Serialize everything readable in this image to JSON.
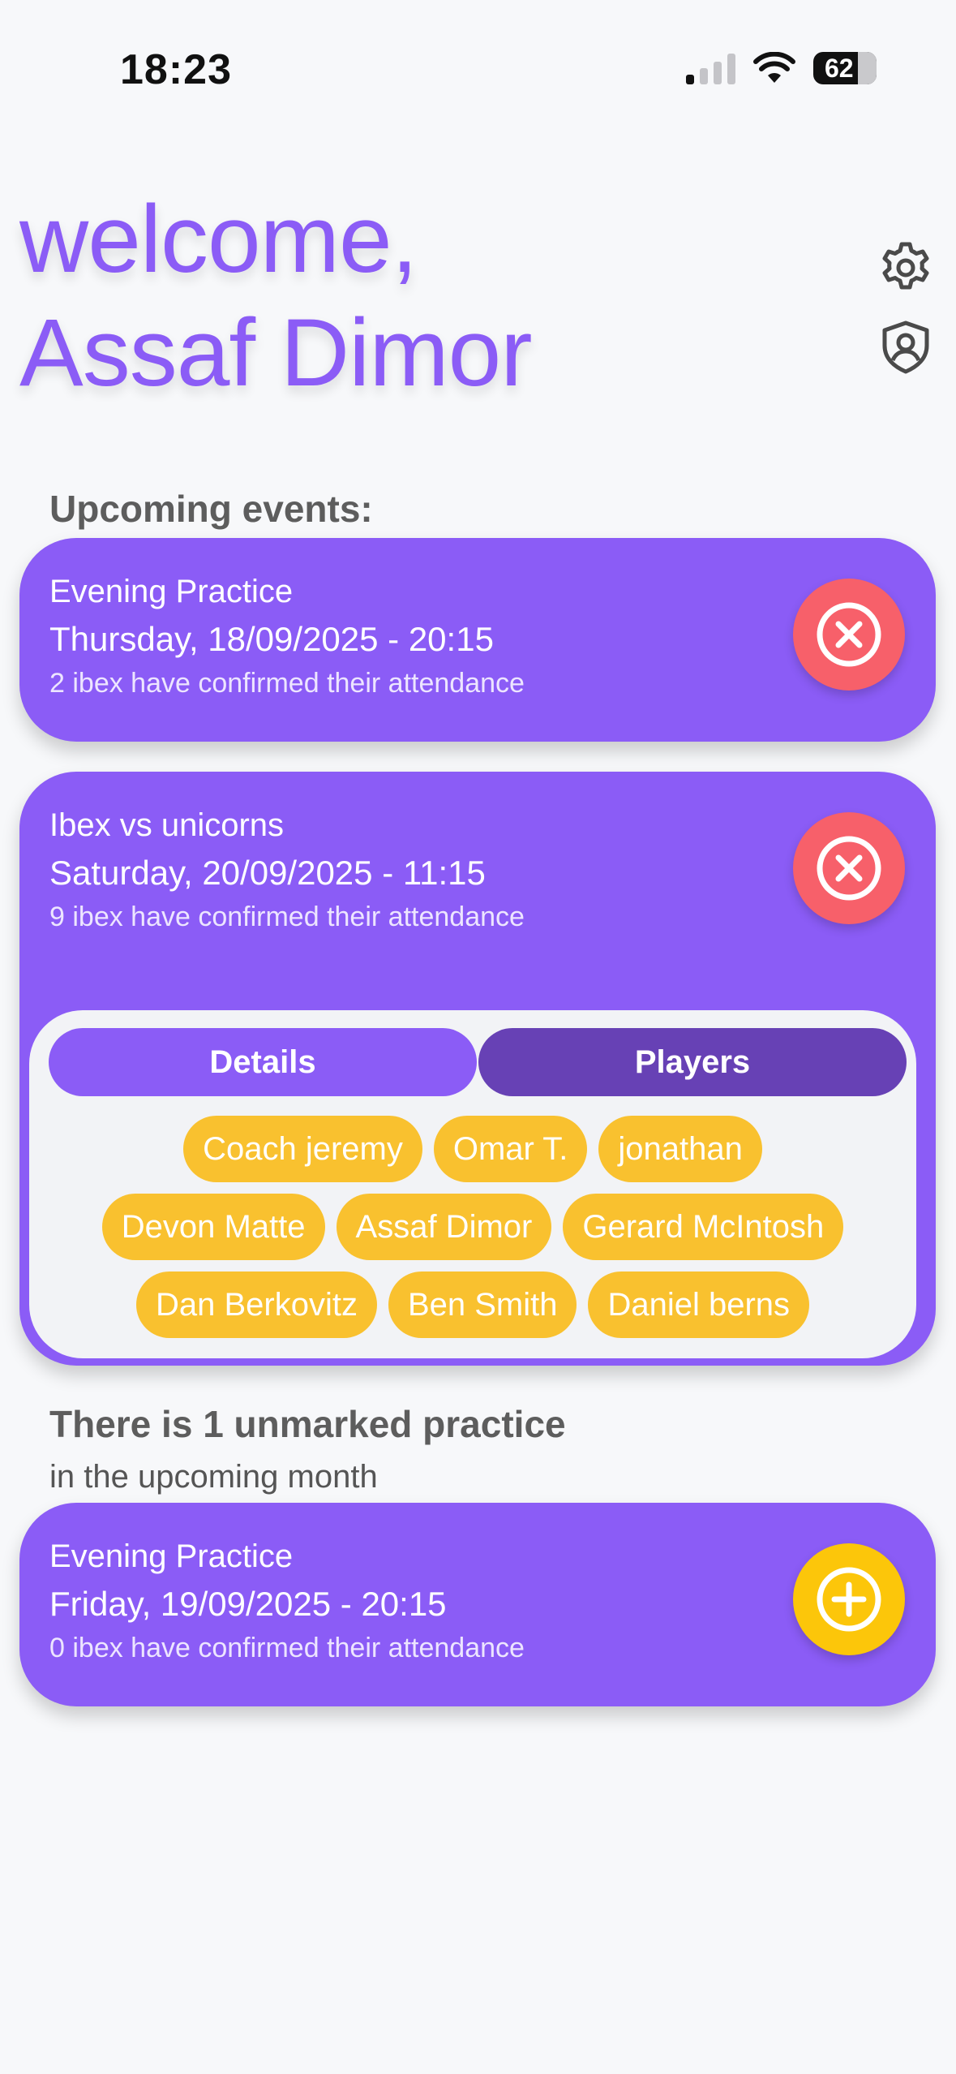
{
  "status_bar": {
    "time": "18:23",
    "battery": "62"
  },
  "header": {
    "greeting": "welcome,",
    "user_name": "Assaf Dimor",
    "settings_icon": "gear-icon",
    "profile_icon": "shield-user-icon"
  },
  "upcoming": {
    "title": "Upcoming events:",
    "events": [
      {
        "title": "Evening Practice",
        "date": "Thursday, 18/09/2025 - 20:15",
        "note": "2 ibex have confirmed their attendance",
        "action_icon": "close-circle-icon"
      },
      {
        "title": "Ibex vs unicorns",
        "date": "Saturday, 20/09/2025 - 11:15",
        "note": "9 ibex have confirmed their attendance",
        "action_icon": "close-circle-icon",
        "tabs": {
          "details": "Details",
          "players": "Players",
          "selected": "Players"
        },
        "players": [
          "Coach jeremy",
          "Omar T.",
          "jonathan",
          "Devon Matte",
          "Assaf Dimor",
          "Gerard McIntosh",
          "Dan Berkovitz",
          "Ben Smith",
          "Daniel berns"
        ]
      }
    ]
  },
  "unmarked": {
    "title": "There is 1 unmarked practice",
    "subtitle": "in the upcoming month",
    "events": [
      {
        "title": "Evening Practice",
        "date": "Friday, 19/09/2025 - 20:15",
        "note": "0 ibex have confirmed their attendance",
        "action_icon": "add-circle-icon"
      }
    ]
  },
  "colors": {
    "primary": "#8b5cf6",
    "primary_dark": "#6741b5",
    "cancel": "#f7606a",
    "add": "#fcc60a",
    "chip": "#f9c12f",
    "background": "#f7f8fa"
  }
}
